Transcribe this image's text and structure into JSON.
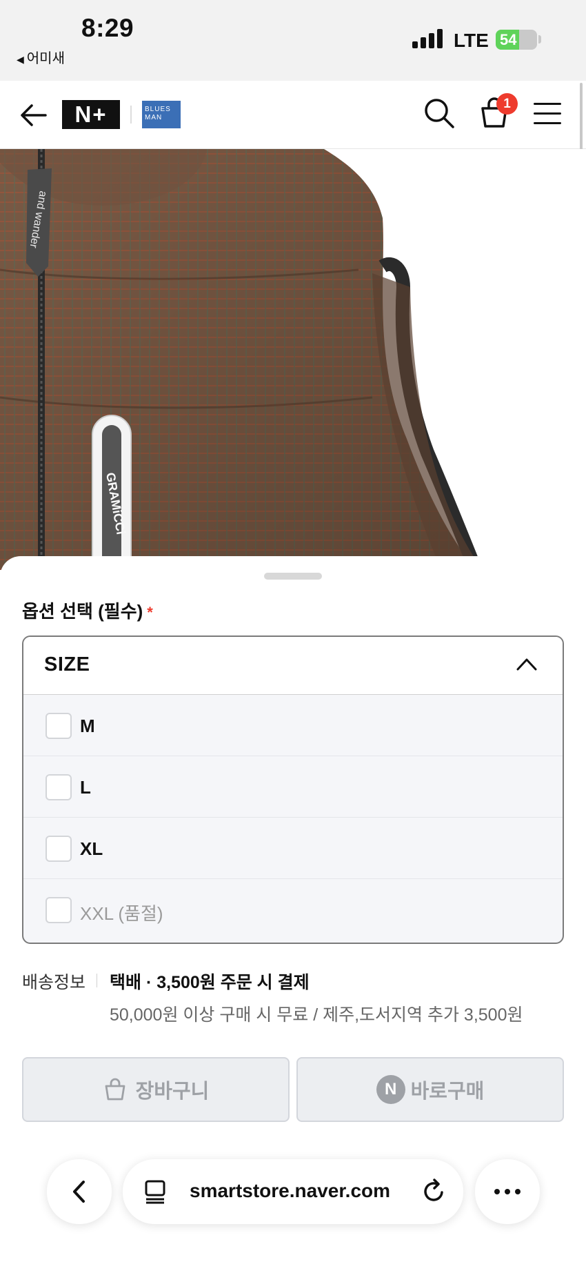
{
  "status_bar": {
    "time": "8:29",
    "back_app": "어미새",
    "network": "LTE",
    "battery": "54",
    "battery_level_percent": 54
  },
  "header": {
    "logo_np": "N+",
    "logo_bluesman": "BLUES MAN",
    "cart_count": "1",
    "icons": [
      "back-arrow-icon",
      "search-icon",
      "cart-icon",
      "menu-icon"
    ]
  },
  "product_image": {
    "zipper_tag_1": "and wander",
    "zipper_tag_2": "GRAMiCCi"
  },
  "option_sheet": {
    "title": "옵션 선택 (필수)",
    "required_mark": "*",
    "dropdown_label": "SIZE",
    "options": [
      {
        "label": "M",
        "checked": false,
        "soldout": false
      },
      {
        "label": "L",
        "checked": false,
        "soldout": false
      },
      {
        "label": "XL",
        "checked": false,
        "soldout": false
      },
      {
        "label": "XXL (품절)",
        "checked": false,
        "soldout": true
      }
    ]
  },
  "shipping": {
    "label": "배송정보",
    "main": "택배 · 3,500원 주문 시 결제",
    "sub": "50,000원 이상 구매 시 무료 / 제주,도서지역 추가 3,500원"
  },
  "actions": {
    "cart_label": "장바구니",
    "buy_label": "바로구매",
    "buy_badge": "N"
  },
  "browser": {
    "url": "smartstore.naver.com"
  },
  "colors": {
    "accent_red": "#ee3b2d",
    "disabled_button_bg": "#eceef1",
    "battery_green": "#5fd35a"
  }
}
